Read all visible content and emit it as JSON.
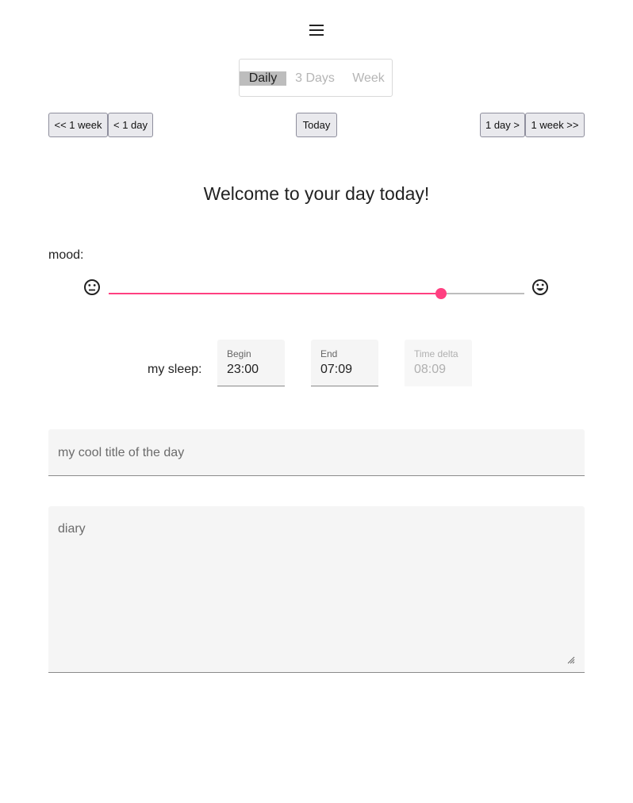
{
  "header": {
    "menu_icon": "hamburger-menu-icon"
  },
  "view_switcher": {
    "options": [
      "Daily",
      "3 Days",
      "Week"
    ],
    "selected": "Daily"
  },
  "nav": {
    "back_week": "<< 1 week",
    "back_day": "< 1 day",
    "today": "Today",
    "fwd_day": "1 day >",
    "fwd_week": "1 week >>"
  },
  "welcome_text": "Welcome to your day today!",
  "mood": {
    "label": "mood:",
    "low_icon": "neutral-face-icon",
    "high_icon": "smiling-face-icon",
    "value_fraction": 0.8,
    "accent_color": "#ff4081"
  },
  "sleep": {
    "label": "my sleep:",
    "begin_label": "Begin",
    "begin_value": "23:00",
    "end_label": "End",
    "end_value": "07:09",
    "delta_label": "Time delta",
    "delta_value": "08:09"
  },
  "title_field": {
    "placeholder": "my cool title of the day"
  },
  "diary_field": {
    "placeholder": "diary"
  }
}
